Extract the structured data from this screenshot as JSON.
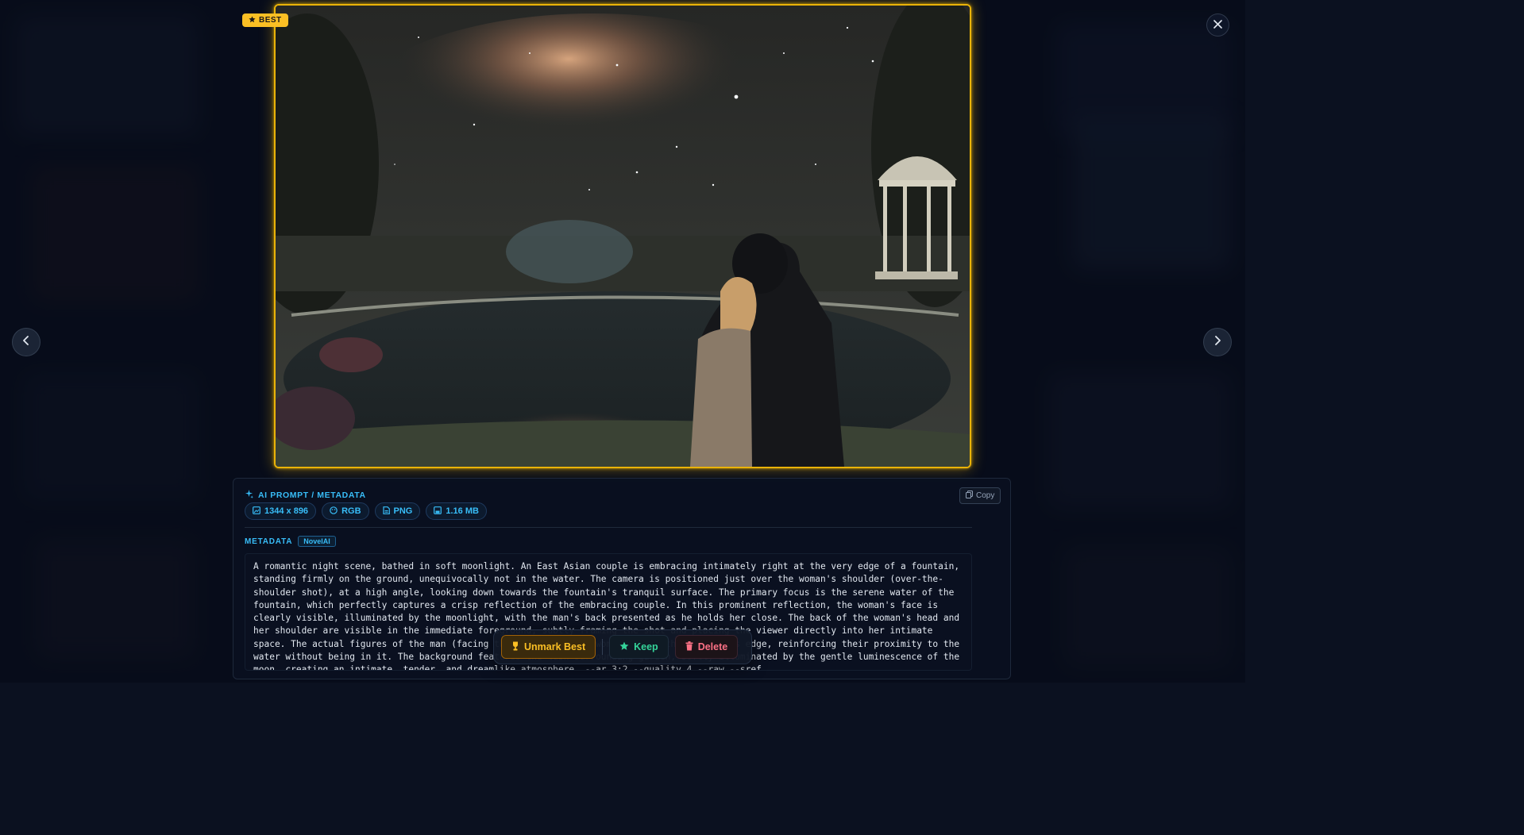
{
  "viewer": {
    "close_icon": "close-icon",
    "prev_icon": "chevron-left-icon",
    "next_icon": "chevron-right-icon"
  },
  "image": {
    "badge": "BEST",
    "accent": "#eab308"
  },
  "metadata_panel": {
    "header": "AI PROMPT / METADATA",
    "copy_label": "Copy",
    "chips": [
      {
        "icon": "image-size-icon",
        "label": "1344 x 896"
      },
      {
        "icon": "palette-icon",
        "label": "RGB"
      },
      {
        "icon": "file-icon",
        "label": "PNG"
      },
      {
        "icon": "disk-icon",
        "label": "1.16 MB"
      }
    ],
    "section_label": "METADATA",
    "source_tag": "NovelAI",
    "prompt": "A romantic night scene, bathed in soft moonlight. An East Asian couple is embracing intimately right at the very edge of a fountain, standing firmly on the ground, unequivocally not in the water. The camera is positioned just over the woman's shoulder (over-the-shoulder shot), at a high angle, looking down towards the fountain's tranquil surface. The primary focus is the serene water of the fountain, which perfectly captures a crisp reflection of the embracing couple. In this prominent reflection, the woman's face is clearly visible, illuminated by the moonlight, with the man's back presented as he holds her close. The back of the woman's head and her shoulder are visible in the immediate foreground, subtly framing the shot and placing the viewer directly into her intimate space. The actual figures of the man (facing the woman) and the woman are at the fountain's edge, reinforcing their proximity to the water without being in it. The background features the lush surrounding garden, softly illuminated by the gentle luminescence of the moon, creating an intimate, tender, and dreamlike atmosphere. --ar 3:2 --quality 4 --raw --sref"
  },
  "actions": {
    "unmark_best": "Unmark Best",
    "keep": "Keep",
    "delete": "Delete"
  }
}
